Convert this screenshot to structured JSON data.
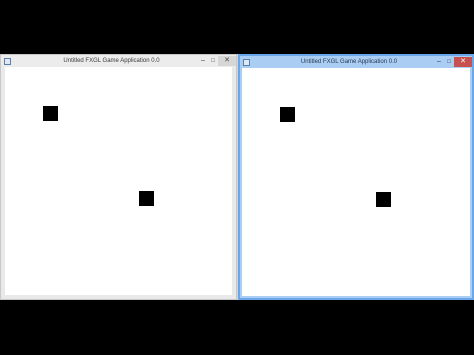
{
  "windows": [
    {
      "title": "Untitled FXGL Game Application 0.0",
      "state": "inactive",
      "controls": {
        "minimize": "–",
        "maximize": "□",
        "close": "✕"
      }
    },
    {
      "title": "Untitled FXGL Game Application 0.0",
      "state": "active",
      "controls": {
        "minimize": "–",
        "maximize": "□",
        "close": "✕"
      }
    }
  ],
  "colors": {
    "active_border": "#6aa6e8",
    "close_button_active": "#c75050",
    "entity": "#000000",
    "canvas": "#ffffff"
  }
}
